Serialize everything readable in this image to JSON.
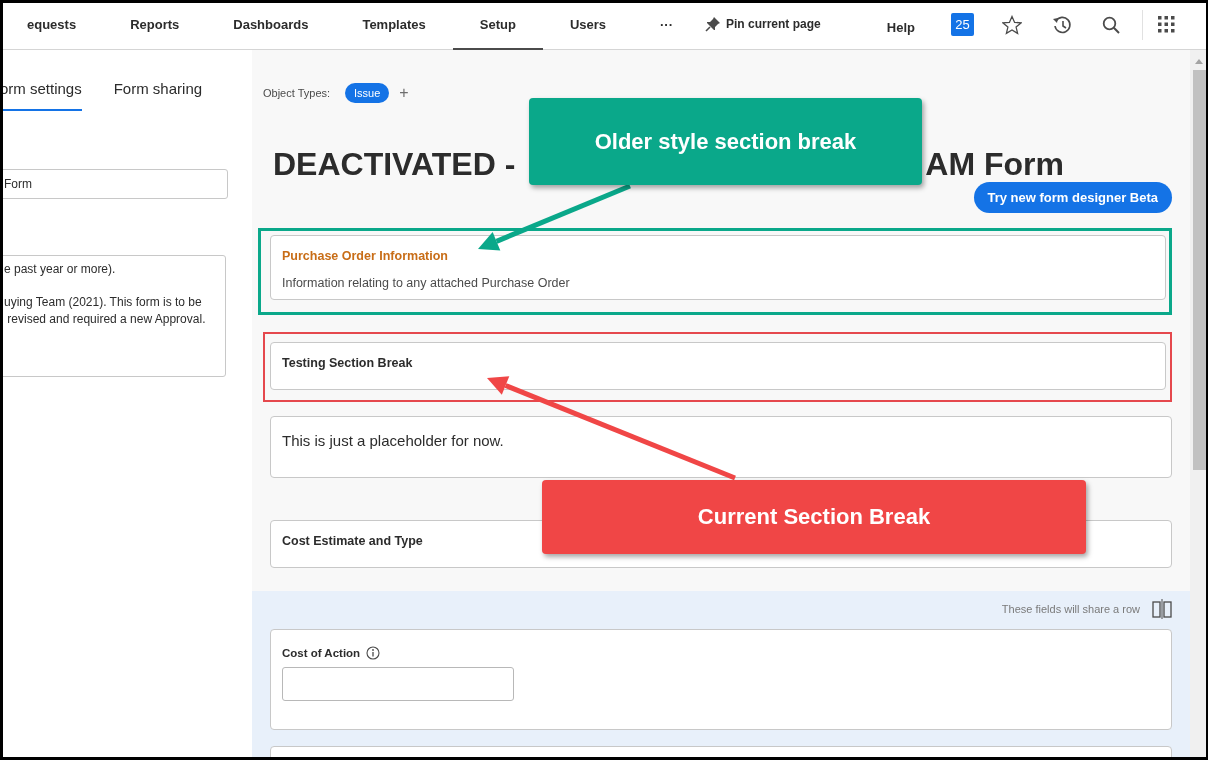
{
  "nav": {
    "items": [
      {
        "label": "equests",
        "selected": false
      },
      {
        "label": "Reports",
        "selected": false
      },
      {
        "label": "Dashboards",
        "selected": false
      },
      {
        "label": "Templates",
        "selected": false
      },
      {
        "label": "Setup",
        "selected": true
      },
      {
        "label": "Users",
        "selected": false
      },
      {
        "label": "···",
        "selected": false
      }
    ],
    "pin": "Pin current page",
    "help": "Help",
    "badge": "25"
  },
  "left_panel": {
    "tabs": [
      {
        "label": "orm settings",
        "selected": true
      },
      {
        "label": "Form sharing",
        "selected": false
      }
    ],
    "name_value": "Form",
    "description_value": "e past year or more).\n\nuying Team (2021). This form is to be\n revised and required a new Approval."
  },
  "object_types": {
    "label": "Object Types:",
    "tags": [
      "Issue"
    ],
    "add": "+"
  },
  "title_start": "DEACTIVATED -",
  "title_end": "AM Form",
  "beta_button": "Try new form designer Beta",
  "sections": [
    {
      "kind": "section",
      "title": "Purchase Order Information",
      "description": "Information relating to any attached Purchase Order",
      "color": "#0aa88a"
    },
    {
      "kind": "section",
      "title": "Testing Section Break",
      "color": "#e5484d"
    },
    {
      "kind": "text",
      "text": "This is just a placeholder for now."
    },
    {
      "kind": "section",
      "title": "Cost Estimate and Type"
    }
  ],
  "shared_row": {
    "hint": "These fields will share a row",
    "fields": [
      {
        "label": "Cost of Action"
      }
    ]
  },
  "annotations": [
    {
      "text": "Older style section break",
      "color": "#0aa88a"
    },
    {
      "text": "Current Section Break",
      "color": "#f04646"
    }
  ]
}
